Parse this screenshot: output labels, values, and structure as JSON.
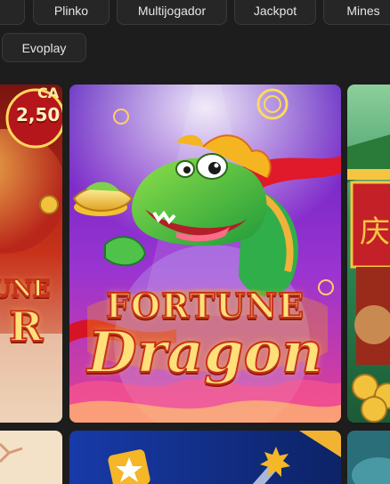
{
  "filters": {
    "row1": [
      "Plinko",
      "Multijogador",
      "Jackpot",
      "Mines"
    ],
    "row2": [
      "Evoplay"
    ]
  },
  "cards": {
    "left_badge_top": "CA",
    "left_badge_amount": "2,50",
    "left_title_line1": "UNE",
    "left_title_line2": "R",
    "main_title_line1": "FORTUNE",
    "main_title_line2": "Dragon",
    "right_sign": "庆"
  },
  "colors": {
    "page_bg": "#1d1d1d",
    "chip_bg": "#262626",
    "chip_border": "#3a3a3a",
    "dragon_green": "#3fbf3a",
    "dragon_bg_top": "#5a1fbf",
    "dragon_bg_bottom": "#e2418f",
    "logo_yellow": "#ffe07a",
    "logo_red": "#c8321a"
  },
  "icons": [
    "star-icon",
    "coin-icon",
    "firework-icon"
  ]
}
